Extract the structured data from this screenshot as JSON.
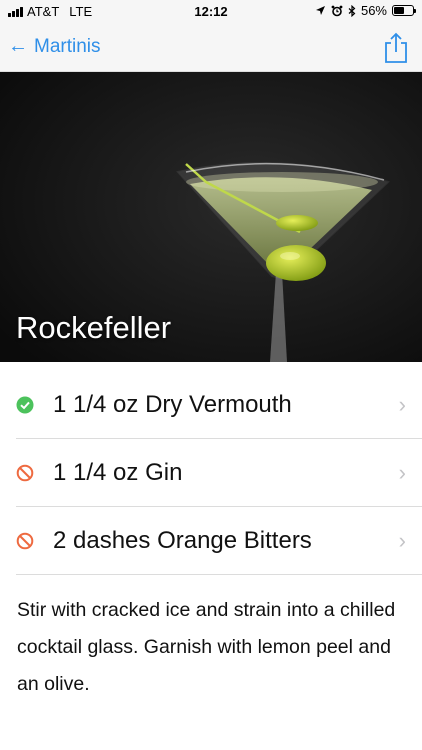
{
  "status_bar": {
    "carrier": "AT&T",
    "network": "LTE",
    "time": "12:12",
    "battery_percent": "56%",
    "battery_level": 0.56,
    "icons": [
      "signal-icon",
      "location-arrow-icon",
      "alarm-icon",
      "bluetooth-icon",
      "battery-icon"
    ]
  },
  "nav": {
    "back_label": "Martinis",
    "back_icon": "back-arrow-icon",
    "share_icon": "share-icon",
    "accent": "#2f8fe8"
  },
  "hero": {
    "title": "Rockefeller",
    "image": "martini-glass-with-olives"
  },
  "ingredients": [
    {
      "label": "1 1/4 oz Dry Vermouth",
      "status": "available",
      "status_icon": "check-circle-icon",
      "color": "#4cc25c"
    },
    {
      "label": "1 1/4 oz Gin",
      "status": "unavailable",
      "status_icon": "prohibited-icon",
      "color": "#ee6a40"
    },
    {
      "label": "2 dashes Orange Bitters",
      "status": "unavailable",
      "status_icon": "prohibited-icon",
      "color": "#ee6a40"
    }
  ],
  "instructions": "Stir with cracked ice and strain into a chilled cocktail glass. Garnish with lemon peel and an olive."
}
